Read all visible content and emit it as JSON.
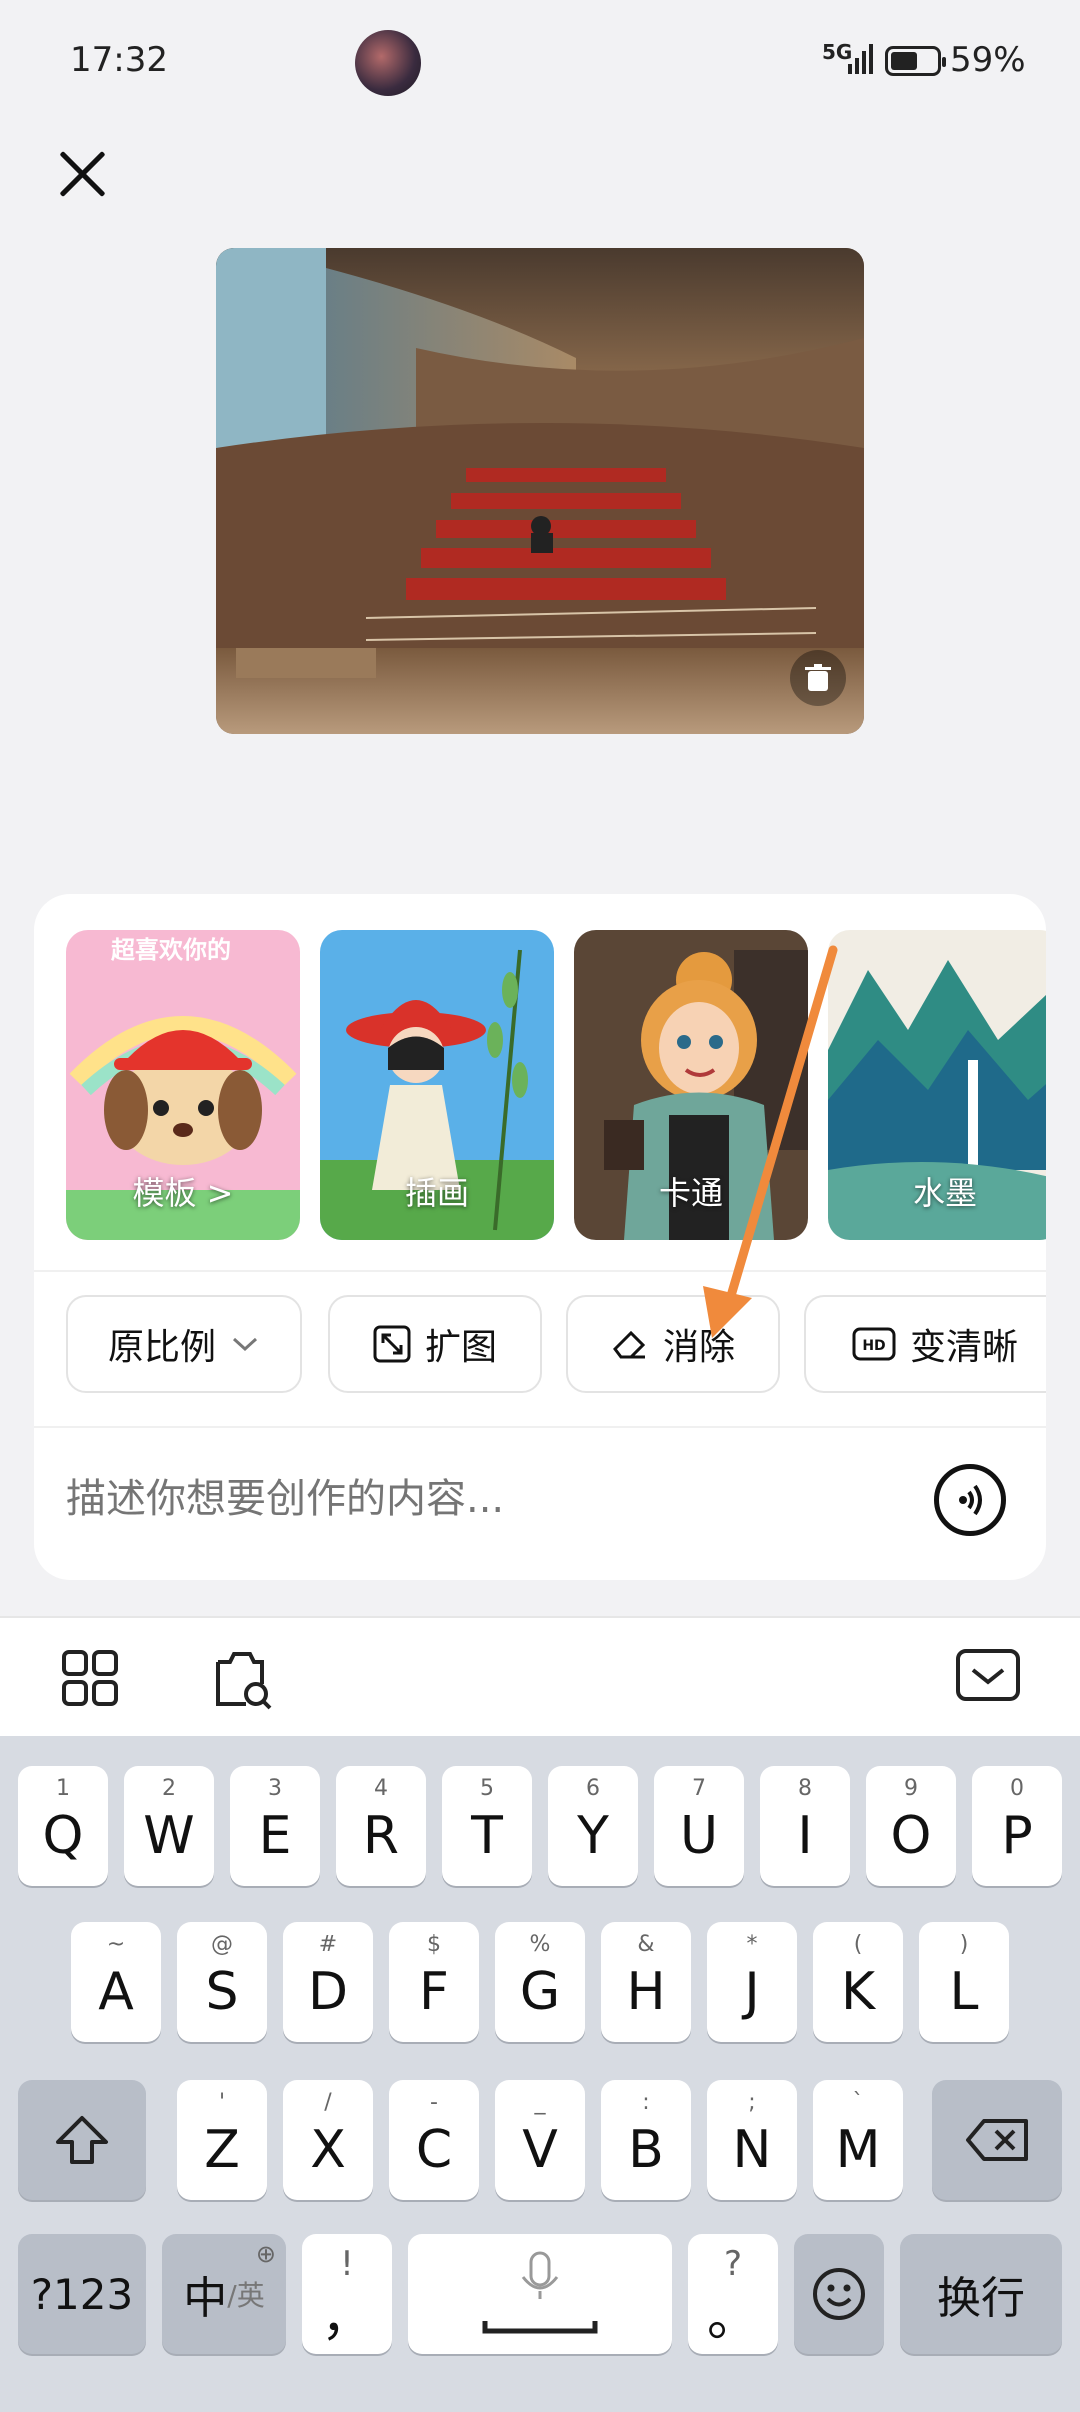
{
  "status": {
    "time": "17:32",
    "network": "5G",
    "battery": "59%"
  },
  "styles": [
    {
      "label": "模板 >",
      "poster_text": "超喜欢你的"
    },
    {
      "label": "插画"
    },
    {
      "label": "卡通"
    },
    {
      "label": "水墨"
    }
  ],
  "tools": [
    {
      "label": "原比例"
    },
    {
      "label": "扩图"
    },
    {
      "label": "消除"
    },
    {
      "label": "变清晰"
    }
  ],
  "prompt": {
    "placeholder": "描述你想要创作的内容..."
  },
  "keyboard": {
    "row1": [
      {
        "k": "Q",
        "s": "1"
      },
      {
        "k": "W",
        "s": "2"
      },
      {
        "k": "E",
        "s": "3"
      },
      {
        "k": "R",
        "s": "4"
      },
      {
        "k": "T",
        "s": "5"
      },
      {
        "k": "Y",
        "s": "6"
      },
      {
        "k": "U",
        "s": "7"
      },
      {
        "k": "I",
        "s": "8"
      },
      {
        "k": "O",
        "s": "9"
      },
      {
        "k": "P",
        "s": "0"
      }
    ],
    "row2": [
      {
        "k": "A",
        "s": "~"
      },
      {
        "k": "S",
        "s": "@"
      },
      {
        "k": "D",
        "s": "#"
      },
      {
        "k": "F",
        "s": "$"
      },
      {
        "k": "G",
        "s": "%"
      },
      {
        "k": "H",
        "s": "&"
      },
      {
        "k": "J",
        "s": "*"
      },
      {
        "k": "K",
        "s": "("
      },
      {
        "k": "L",
        "s": ")"
      }
    ],
    "row3": [
      {
        "k": "Z",
        "s": "'"
      },
      {
        "k": "X",
        "s": "/"
      },
      {
        "k": "C",
        "s": "-"
      },
      {
        "k": "V",
        "s": "_"
      },
      {
        "k": "B",
        "s": ":"
      },
      {
        "k": "N",
        "s": ";"
      },
      {
        "k": "M",
        "s": "`"
      }
    ],
    "num_label": "?123",
    "lang_label": "中",
    "lang_sub": "/英",
    "comma_top": "!",
    "comma": "，",
    "period_top": "?",
    "period": "。",
    "enter_label": "换行"
  },
  "colors": {
    "arrow": "#f08a3c",
    "panel": "#ffffff",
    "keyboard": "#d7dbe2"
  }
}
